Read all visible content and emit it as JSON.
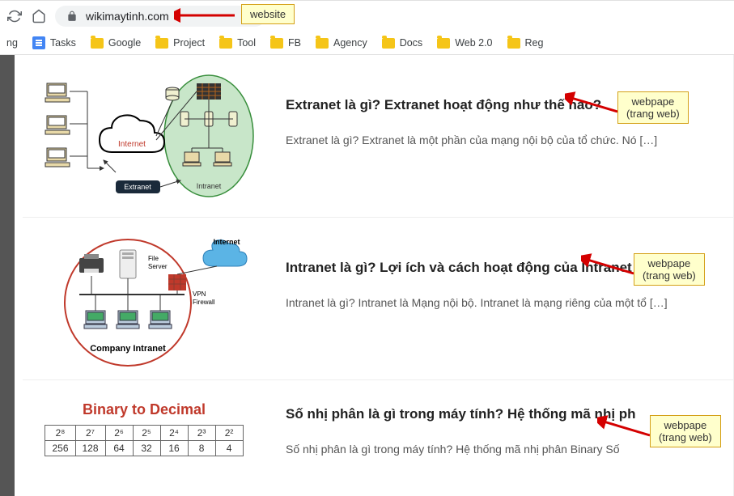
{
  "browser": {
    "url": "wikimaytinh.com"
  },
  "bookmarks": {
    "partial": "ng",
    "items": [
      "Tasks",
      "Google",
      "Project",
      "Tool",
      "FB",
      "Agency",
      "Docs",
      "Web 2.0",
      "Reg"
    ]
  },
  "articles": [
    {
      "title": "Extranet là gì? Extranet hoạt động như thế nào?",
      "excerpt": "Extranet là gì? Extranet là một phần của mạng nội bộ của tổ chức. Nó […]"
    },
    {
      "title": "Intranet là gì? Lợi ích và cách hoạt động của Intranet",
      "excerpt": "Intranet là gì? Intranet là Mạng nội bộ. Intranet là mạng riêng của một tổ […]"
    },
    {
      "title": "Số nhị phân là gì trong máy tính? Hệ thống mã nhị ph",
      "excerpt": "Số nhị phân là gì trong máy tính? Hệ thống mã nhị phân Binary Số"
    }
  ],
  "thumb1": {
    "internet_label": "Internet",
    "extranet_label": "Extranet",
    "intranet_label": "Intranet"
  },
  "thumb2": {
    "internet_label": "Internet",
    "file_server": "File\nServer",
    "vpn": "VPN\nFirewall",
    "caption": "Company Intranet"
  },
  "thumb3": {
    "caption": "Binary to Decimal",
    "row1": [
      "2⁸",
      "2⁷",
      "2⁶",
      "2⁵",
      "2⁴",
      "2³",
      "2²"
    ],
    "row2": [
      "256",
      "128",
      "64",
      "32",
      "16",
      "8",
      "4"
    ]
  },
  "annotations": {
    "website": "website",
    "webpage": "webpape\n(trang web)"
  }
}
